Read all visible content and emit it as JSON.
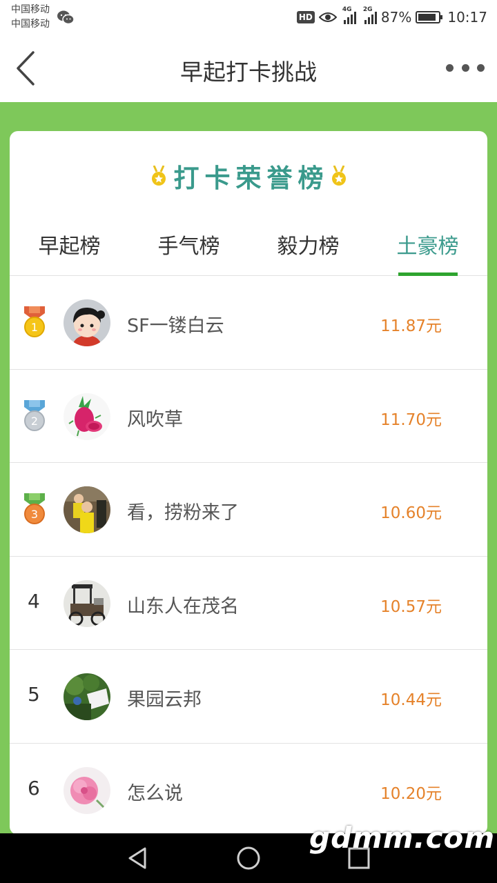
{
  "status_bar": {
    "carrier_1": "中国移动",
    "carrier_2": "中国移动",
    "hd": "HD",
    "sig1_tag": "4G",
    "sig2_tag": "2G",
    "battery_text": "87%",
    "battery_level": 0.87,
    "time": "10:17"
  },
  "header": {
    "title": "早起打卡挑战"
  },
  "card": {
    "title": "打卡荣誉榜",
    "tabs": [
      {
        "label": "早起榜",
        "active": false
      },
      {
        "label": "手气榜",
        "active": false
      },
      {
        "label": "毅力榜",
        "active": false
      },
      {
        "label": "土豪榜",
        "active": true
      }
    ]
  },
  "rankings": [
    {
      "rank": "1",
      "medal": "gold",
      "name": "SF一镂白云",
      "amount": "11.87元",
      "avatar": "cartoon-girl-avatar"
    },
    {
      "rank": "2",
      "medal": "silver",
      "name": "风吹草",
      "amount": "11.70元",
      "avatar": "dragon-fruit-avatar"
    },
    {
      "rank": "3",
      "medal": "bronze",
      "name": "看，捞粉来了",
      "amount": "10.60元",
      "avatar": "children-photo-avatar"
    },
    {
      "rank": "4",
      "medal": "",
      "name": "山东人在茂名",
      "amount": "10.57元",
      "avatar": "tricycle-photo-avatar"
    },
    {
      "rank": "5",
      "medal": "",
      "name": "果园云邦",
      "amount": "10.44元",
      "avatar": "orchard-photo-avatar"
    },
    {
      "rank": "6",
      "medal": "",
      "name": "怎么说",
      "amount": "10.20元",
      "avatar": "pink-flower-avatar"
    }
  ],
  "watermark": "gdmm.com",
  "colors": {
    "page_green": "#7ec85a",
    "teal_title": "#3a9a8c",
    "tab_underline": "#2ea42f",
    "amount_orange": "#e5822a"
  }
}
